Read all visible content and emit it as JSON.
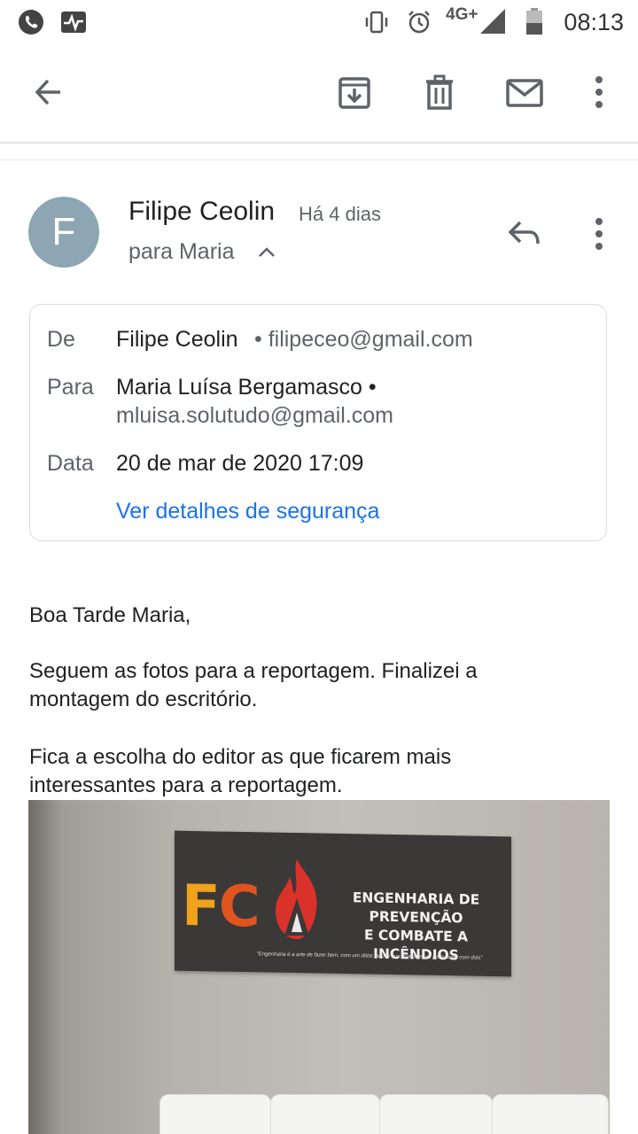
{
  "status_bar": {
    "time": "08:13",
    "network": "4G+",
    "icons": [
      "phone-icon",
      "activity-icon",
      "vibrate-icon",
      "alarm-icon",
      "signal-icon",
      "battery-icon"
    ]
  },
  "app_bar": {
    "icons": [
      "back-arrow-icon",
      "archive-icon",
      "delete-icon",
      "mark-unread-icon",
      "more-vert-icon"
    ]
  },
  "header": {
    "avatar_letter": "F",
    "sender": "Filipe Ceolin",
    "time_ago": "Há 4 dias",
    "recipient": "para Maria"
  },
  "details": {
    "from_label": "De",
    "from_name": "Filipe Ceolin",
    "from_email": "• filipeceo@gmail.com",
    "to_label": "Para",
    "to_name": "Maria Luísa Bergamasco •",
    "to_email": "mluisa.solutudo@gmail.com",
    "date_label": "Data",
    "date_value": "20 de mar de 2020 17:09",
    "security_link": "Ver detalhes de segurança"
  },
  "body": {
    "greeting": "Boa Tarde Maria,",
    "para1_line1": "Seguem as fotos para a reportagem. Finalizei a",
    "para1_line2": "montagem do escritório.",
    "para2_line1": "Fica a escolha do editor as que ficarem mais",
    "para2_line2": "interessantes para a reportagem."
  },
  "photo": {
    "logo_f": "F",
    "logo_c": "C",
    "banner_line1": "ENGENHARIA DE PREVENÇÃO",
    "banner_line2": "E COMBATE A INCÊNDIOS",
    "quote": "\"Engenharia é a arte de fazer bem, com um dólar, aquilo que qualquer um pode fazer com dois\""
  },
  "colors": {
    "accent_link": "#1a73e8",
    "avatar_bg": "#8ea5b4",
    "logo_orange": "#f0a21a",
    "logo_red": "#e0541d"
  }
}
